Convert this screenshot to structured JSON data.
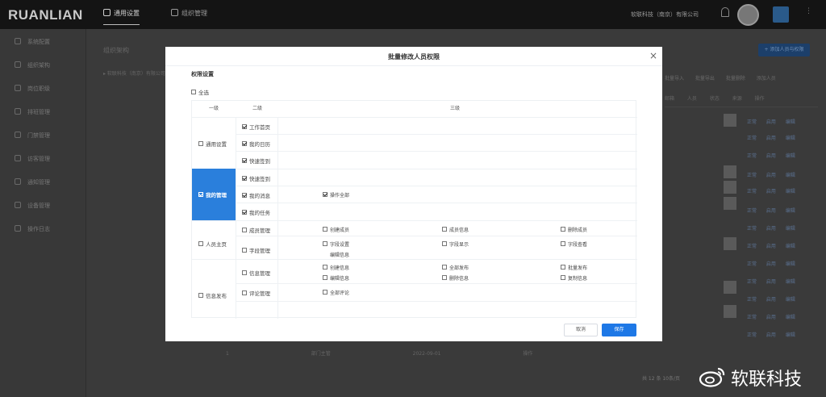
{
  "app": {
    "logo": "RUANLIAN",
    "tabs": [
      {
        "label": "通用设置",
        "active": true
      },
      {
        "label": "组织管理",
        "active": false
      }
    ],
    "company": "软联科技（南京）有限公司",
    "watermark": "软联科技"
  },
  "sidebar": {
    "items": [
      {
        "label": "系统配置"
      },
      {
        "label": "组织架构"
      },
      {
        "label": "岗位职级"
      },
      {
        "label": "排班管理"
      },
      {
        "label": "门禁管理"
      },
      {
        "label": "访客管理"
      },
      {
        "label": "通知管理"
      },
      {
        "label": "设备管理"
      },
      {
        "label": "操作日志"
      }
    ]
  },
  "background": {
    "title": "组织架构",
    "add_button": "+ 添加人员与权限",
    "tree": "▸ 软联科技（南京）有限公司",
    "actions": "批量导入 批量导出 批量删除 添加人员",
    "header": "邮箱 人员 状态 来源 操作",
    "row_links": "正常 启用 编辑",
    "bottom": "1 部门主管 2022-09-01 操作",
    "pagination": "共 12 条  10条/页"
  },
  "modal": {
    "title": "批量修改人员权限",
    "close": "×",
    "section": "权限设置",
    "select_all": "全选",
    "headers": {
      "level1": "一级",
      "level2": "二级",
      "level3": "三级"
    },
    "groups": [
      {
        "label": "通用设置",
        "checked": false,
        "active": false,
        "rows": [
          {
            "label": "工作首页",
            "checked": true,
            "perms": []
          },
          {
            "label": "我的日历",
            "checked": true,
            "perms": []
          },
          {
            "label": "快速签到",
            "checked": true,
            "perms": []
          }
        ]
      },
      {
        "label": "我的管理",
        "checked": true,
        "active": true,
        "rows": [
          {
            "label": "快速签到",
            "checked": true,
            "perms": []
          },
          {
            "label": "我的消息",
            "checked": true,
            "perms": [
              "操作全部"
            ]
          },
          {
            "label": "我的任务",
            "checked": true,
            "perms": []
          }
        ]
      },
      {
        "label": "人员主页",
        "checked": false,
        "active": false,
        "rows": [
          {
            "label": "成员管理",
            "checked": false,
            "perms": [
              "创建成员",
              "成员信息",
              "删除成员"
            ]
          },
          {
            "label": "字段管理",
            "checked": false,
            "perms": [
              "字段设置",
              "编辑信息",
              "字段显示",
              "字段查看"
            ]
          }
        ]
      },
      {
        "label": "信息发布",
        "checked": false,
        "active": false,
        "rows": [
          {
            "label": "信息管理",
            "checked": false,
            "perms": [
              "创建信息",
              "全部发布",
              "批量发布",
              "编辑信息",
              "删除信息",
              "复制信息"
            ]
          },
          {
            "label": "评论管理",
            "checked": false,
            "perms": [
              "全部评论"
            ]
          }
        ]
      }
    ],
    "cancel": "取消",
    "save": "保存"
  },
  "colors": {
    "accent": "#1e78e6",
    "active_cell": "#2a7fdc",
    "topbar": "#141414"
  }
}
